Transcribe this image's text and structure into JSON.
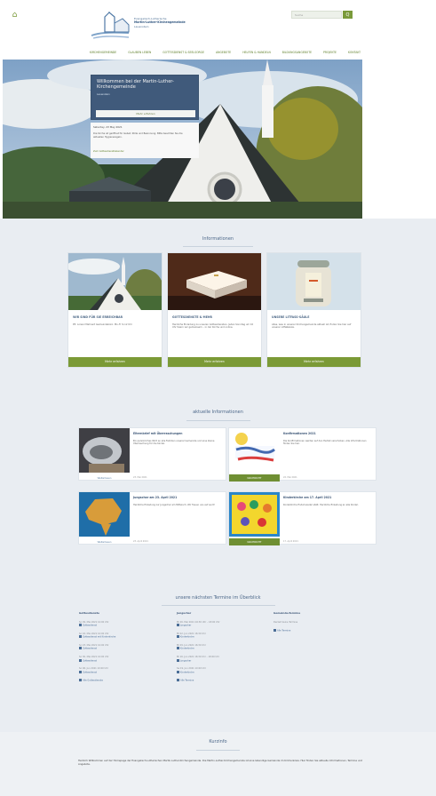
{
  "header": {
    "logo_line1": "Evangelisch-Lutherische",
    "logo_line2": "Martin-Luther-Kirchengemeinde",
    "logo_line3": "Lauenstein",
    "search_placeholder": "Suche",
    "search_button": "Q"
  },
  "nav": [
    "KIRCHENGEMEINDE",
    "GLAUBEN LEBEN",
    "GOTTESDIENST & SEELSORGE",
    "ANGEBOTE",
    "HELFEN & HANDELN",
    "BILDUNGSANGEBOTE",
    "PROJEKTE",
    "KONTAKT"
  ],
  "hero": {
    "welcome_title": "Willkommen bei der Martin-Luther-Kirchengemeinde",
    "welcome_sub": "Lauenstein",
    "welcome_button": "Mehr erfahren",
    "info_a": "Saturday, 23 May 2021",
    "info_b": "Die Kirche ist geöffnet für Gebet, Stille und Besinnung. Bitte beachten Sie die aktuellen Hygieneregeln.",
    "info_c": "Zum Gottesdienstkalender"
  },
  "sections": {
    "informationen": "Informationen",
    "aktuelles": "aktuelle Informationen",
    "termine": "unsere nächsten Termine im Überblick",
    "kurzinfo": "Kurzinfo"
  },
  "cards": [
    {
      "title": "WIR SIND FÜR SIE ERREICHBAR",
      "text": "Pfr. Lorenz Mehnert\nGemeindebüro: Mo–Fr 9–12 Uhr",
      "button": "Mehr erfahren"
    },
    {
      "title": "GOTTESDIENSTE & MEHR",
      "text": "Herzliche Einladung zu unseren Gottesdiensten. Jeden Sonntag um 10 Uhr feiern wir gemeinsam – in der Kirche und online.",
      "button": "Mehr erfahren"
    },
    {
      "title": "UNSERE LITFASS-SÄULE",
      "text": "Alles, was in unserer Kirchengemeinde aktuell ist, finden Sie hier auf unserer Litfaßsäule.",
      "button": "Mehr erfahren"
    }
  ],
  "news": [
    {
      "title": "Elternbrief mit Überraschungen",
      "text": "Ein persönliches Wort an alle Familien unserer Gemeinde und eine kleine Überraschung für die Kinder.",
      "cap": "Weiterlesen",
      "date": "23. Mai 2021"
    },
    {
      "title": "Konfirmationen 2021",
      "text": "Die Konfirmationen werden auf den Herbst verschoben. Alle Informationen finden Sie hier.",
      "cap": "NACHRICHT",
      "date": "22. Mai 2021"
    },
    {
      "title": "Jungschar am 23. April 2021",
      "text": "Herzliche Einladung zur Jungschar am Mittwoch. Wir freuen uns auf euch!",
      "cap": "Weiterlesen",
      "date": "23. April 2021"
    },
    {
      "title": "Kinderkirche am 17. April 2021",
      "text": "Kinderkirche findet wieder statt. Herzliche Einladung an alle Kinder.",
      "cap": "NACHRICHT",
      "date": "17. April 2021"
    }
  ],
  "events": {
    "col1": {
      "head": "Gottesdienste",
      "items": [
        [
          "So 09. Mai 2021 10:00 Uhr",
          "Gottesdienst"
        ],
        [
          "So 16. Mai 2021 10:00 Uhr",
          "Gottesdienst mit Kinderkirche"
        ],
        [
          "So 23. Mai 2021 10:00 Uhr",
          "Gottesdienst"
        ],
        [
          "So 30. Mai 2021 10:00 Uhr",
          "Gottesdienst"
        ],
        [
          "So 06. Jun 2021 10:00 Uhr",
          "Gottesdienst"
        ]
      ],
      "more": "Alle Gottesdienste"
    },
    "col2": {
      "head": "Jungschar",
      "items": [
        [
          "Mi 26. Mai 2021 16:30 Uhr – 18:00 Uhr",
          "Jungschar"
        ],
        [
          "Mi 02. Jun 2021 16:30 Uhr",
          "Kinderkirche"
        ],
        [
          "Mi 09. Jun 2021 16:30 Uhr",
          "Kinderkirche"
        ],
        [
          "Mi 16. Jun 2021 16:30 Uhr – 18:00 Uhr",
          "Jungschar"
        ],
        [
          "Sa 19. Jun 2021 10:00 Uhr",
          "Kinderkirche"
        ]
      ],
      "more": "Alle Termine"
    },
    "col3": {
      "head": "Gemeinde-Termine",
      "items": [
        [
          "Derzeit keine Termine",
          ""
        ]
      ],
      "more": "Alle Termine"
    }
  },
  "footer": {
    "text": "Herzlich Willkommen auf der Homepage der Evangelisch-Lutherischen Martin-Luther-Kirchengemeinde. Die Martin-Luther-Kirchengemeinde ist eine lebendige Gemeinde im Kirchenkreis. Hier finden Sie aktuelle Informationen, Termine und Angebote."
  }
}
